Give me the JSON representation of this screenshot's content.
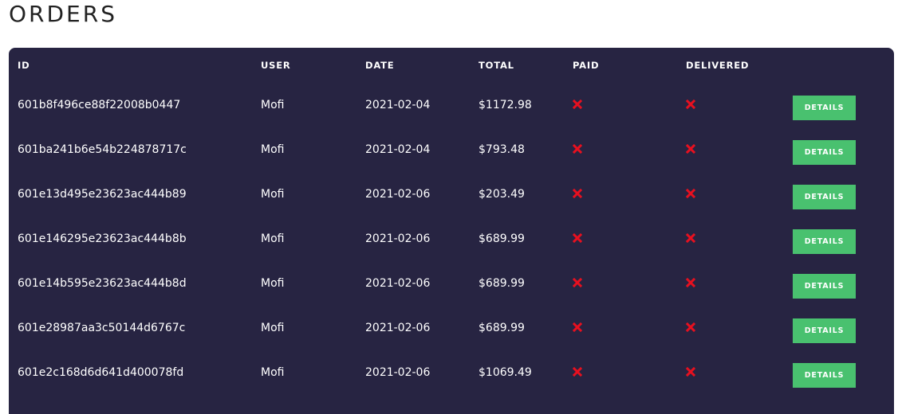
{
  "page": {
    "title": "ORDERS"
  },
  "colors": {
    "table_bg": "#272442",
    "details_button": "#49c16f",
    "not_done_icon": "#e8101f"
  },
  "table": {
    "headers": {
      "id": "ID",
      "user": "USER",
      "date": "DATE",
      "total": "TOTAL",
      "paid": "PAID",
      "delivered": "DELIVERED"
    },
    "details_label": "DETAILS",
    "status_icon": "times-icon",
    "rows": [
      {
        "id": "601b8f496ce88f22008b0447",
        "user": "Mofi",
        "date": "2021-02-04",
        "total": "$1172.98"
      },
      {
        "id": "601ba241b6e54b224878717c",
        "user": "Mofi",
        "date": "2021-02-04",
        "total": "$793.48"
      },
      {
        "id": "601e13d495e23623ac444b89",
        "user": "Mofi",
        "date": "2021-02-06",
        "total": "$203.49"
      },
      {
        "id": "601e146295e23623ac444b8b",
        "user": "Mofi",
        "date": "2021-02-06",
        "total": "$689.99"
      },
      {
        "id": "601e14b595e23623ac444b8d",
        "user": "Mofi",
        "date": "2021-02-06",
        "total": "$689.99"
      },
      {
        "id": "601e28987aa3c50144d6767c",
        "user": "Mofi",
        "date": "2021-02-06",
        "total": "$689.99"
      },
      {
        "id": "601e2c168d6d641d400078fd",
        "user": "Mofi",
        "date": "2021-02-06",
        "total": "$1069.49"
      }
    ]
  }
}
